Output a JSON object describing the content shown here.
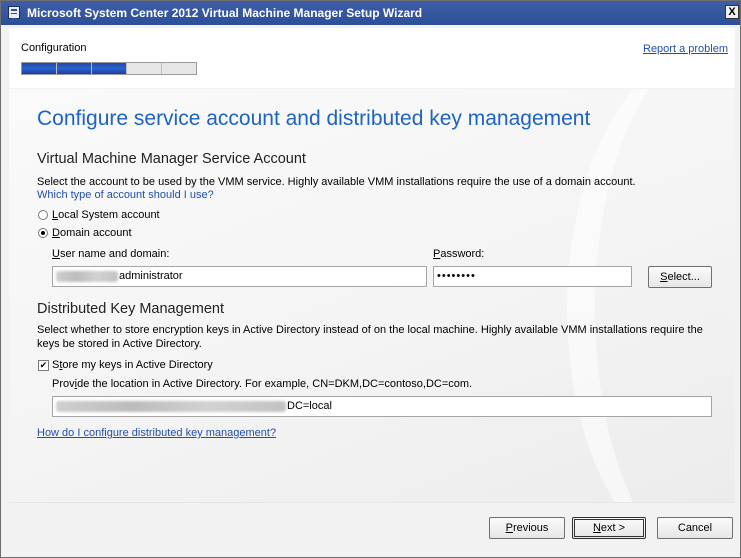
{
  "window": {
    "title": "Microsoft System Center 2012 Virtual Machine Manager Setup Wizard",
    "close_symbol": "X"
  },
  "header": {
    "step_label": "Configuration",
    "progress": {
      "completed_steps": 3,
      "total_steps": 5
    },
    "report_link": "Report a problem"
  },
  "main": {
    "page_title": "Configure service account and distributed key management",
    "service_account": {
      "section_title": "Virtual Machine Manager Service Account",
      "description": "Select the account to be used by the VMM service. Highly available VMM installations require the use of a domain account.",
      "help_link": "Which type of account should I use?",
      "options": [
        {
          "label": "Local System account",
          "checked": false
        },
        {
          "label": "Domain account",
          "checked": true
        }
      ],
      "username_label": "User name and domain:",
      "username_value_visible": "administrator",
      "password_label": "Password:",
      "password_value": "••••••••",
      "select_button": "Select..."
    },
    "key_management": {
      "section_title": "Distributed Key Management",
      "description_line1": "Select whether to store encryption keys in Active Directory instead of on the local machine. Highly available VMM installations require the",
      "description_line2": "keys be stored in Active Directory.",
      "store_checkbox_label": "Store my keys in Active Directory",
      "store_checked": true,
      "location_help": "Provide the location in Active Directory. For example, CN=DKM,DC=contoso,DC=com.",
      "location_value_visible": "DC=local",
      "help_link": "How do I configure distributed key management?"
    }
  },
  "footer": {
    "previous": "Previous",
    "next": "Next >",
    "cancel": "Cancel"
  },
  "colors": {
    "title_blue": "#1d63c3",
    "link_blue": "#1f4fb3",
    "titlebar": "#2d4f97"
  }
}
